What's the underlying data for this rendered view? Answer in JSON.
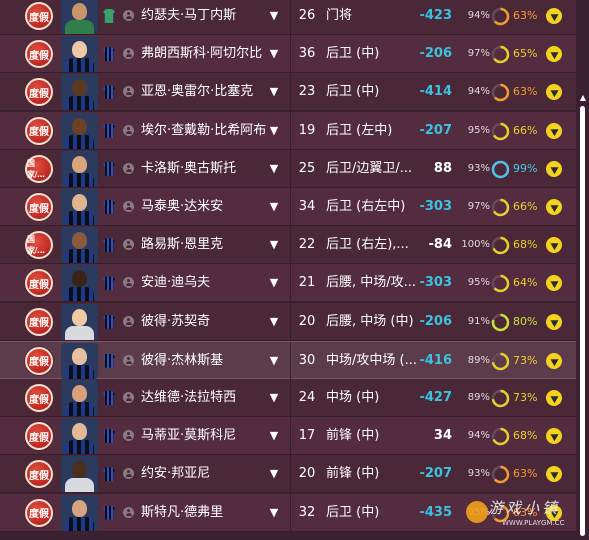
{
  "players": [
    {
      "badge": "度假",
      "kit": "gk",
      "name": "约瑟夫·马丁内斯",
      "age": "26",
      "position": "门将",
      "rating": "-423",
      "rating_sign": "neg",
      "pct": "94%",
      "ring_pct": "63%",
      "ring_color": "#f39c2e",
      "ring_value": 0.63
    },
    {
      "badge": "度假",
      "kit": "home",
      "name": "弗朗西斯科·阿切尔比",
      "age": "36",
      "position": "后卫 (中)",
      "rating": "-206",
      "rating_sign": "neg",
      "pct": "97%",
      "ring_pct": "65%",
      "ring_color": "#e8d02a",
      "ring_value": 0.65
    },
    {
      "badge": "度假",
      "kit": "home",
      "name": "亚恩·奥雷尔·比塞克",
      "age": "23",
      "position": "后卫 (中)",
      "rating": "-414",
      "rating_sign": "neg",
      "pct": "94%",
      "ring_pct": "63%",
      "ring_color": "#f39c2e",
      "ring_value": 0.63
    },
    {
      "badge": "度假",
      "kit": "home",
      "name": "埃尔·查戴勒·比希阿布",
      "age": "19",
      "position": "后卫 (左中)",
      "rating": "-207",
      "rating_sign": "neg",
      "pct": "95%",
      "ring_pct": "66%",
      "ring_color": "#e8d02a",
      "ring_value": 0.66
    },
    {
      "badge": "国家/...",
      "kit": "home",
      "name": "卡洛斯·奥古斯托",
      "age": "25",
      "position": "后卫/边翼卫/...",
      "rating": "88",
      "rating_sign": "pos",
      "pct": "93%",
      "ring_pct": "99%",
      "ring_color": "#4fc3ea",
      "ring_value": 0.99
    },
    {
      "badge": "度假",
      "kit": "home",
      "name": "马泰奥·达米安",
      "age": "34",
      "position": "后卫 (右左中)",
      "rating": "-303",
      "rating_sign": "neg",
      "pct": "97%",
      "ring_pct": "66%",
      "ring_color": "#e8d02a",
      "ring_value": 0.66
    },
    {
      "badge": "国家/...",
      "kit": "home",
      "name": "路易斯·恩里克",
      "age": "22",
      "position": "后卫 (右左),...",
      "rating": "-84",
      "rating_sign": "pos",
      "pct": "100%",
      "ring_pct": "68%",
      "ring_color": "#e8d02a",
      "ring_value": 0.68
    },
    {
      "badge": "度假",
      "kit": "home",
      "name": "安迪·迪乌夫",
      "age": "21",
      "position": "后腰, 中场/攻...",
      "rating": "-303",
      "rating_sign": "neg",
      "pct": "95%",
      "ring_pct": "64%",
      "ring_color": "#e8d02a",
      "ring_value": 0.64
    },
    {
      "badge": "度假",
      "kit": "other",
      "name": "彼得·苏契奇",
      "age": "20",
      "position": "后腰, 中场 (中)",
      "rating": "-206",
      "rating_sign": "neg",
      "pct": "91%",
      "ring_pct": "80%",
      "ring_color": "#c8e23a",
      "ring_value": 0.8
    },
    {
      "badge": "度假",
      "kit": "home",
      "name": "彼得·杰林斯基",
      "age": "30",
      "position": "中场/攻中场 (...",
      "rating": "-416",
      "rating_sign": "neg",
      "pct": "89%",
      "ring_pct": "73%",
      "ring_color": "#e8d02a",
      "ring_value": 0.73
    },
    {
      "badge": "度假",
      "kit": "home",
      "name": "达维德·法拉特西",
      "age": "24",
      "position": "中场 (中)",
      "rating": "-427",
      "rating_sign": "neg",
      "pct": "89%",
      "ring_pct": "73%",
      "ring_color": "#e8d02a",
      "ring_value": 0.73
    },
    {
      "badge": "度假",
      "kit": "home",
      "name": "马蒂亚·莫斯科尼",
      "age": "17",
      "position": "前锋 (中)",
      "rating": "34",
      "rating_sign": "pos",
      "pct": "94%",
      "ring_pct": "68%",
      "ring_color": "#e8d02a",
      "ring_value": 0.68
    },
    {
      "badge": "度假",
      "kit": "other",
      "name": "约安·邦亚尼",
      "age": "20",
      "position": "前锋 (中)",
      "rating": "-207",
      "rating_sign": "neg",
      "pct": "93%",
      "ring_pct": "63%",
      "ring_color": "#f39c2e",
      "ring_value": 0.63
    },
    {
      "badge": "度假",
      "kit": "home",
      "name": "斯特凡·德弗里",
      "age": "32",
      "position": "后卫 (中)",
      "rating": "-435",
      "rating_sign": "neg",
      "pct": "95%",
      "ring_pct": "63%",
      "ring_color": "#f39c2e",
      "ring_value": 0.63
    }
  ],
  "selected_index": 9,
  "watermark": {
    "text": "游戏小镇",
    "url": "WWW.PLAYGM.CC"
  },
  "colors": {
    "negative_rating": "#39c3df",
    "action": "#f4d21f",
    "badge": "#c42c25"
  }
}
